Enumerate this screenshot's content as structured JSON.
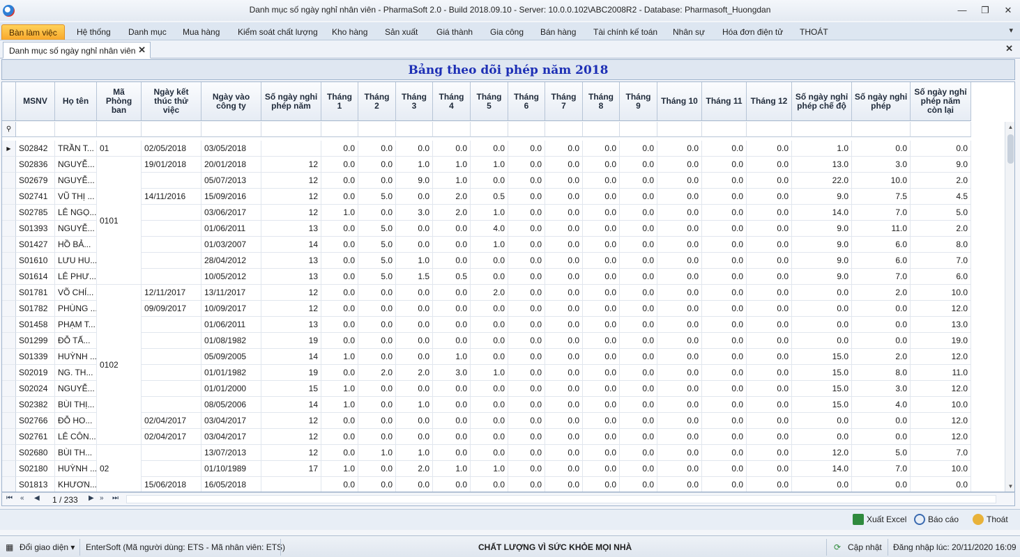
{
  "window": {
    "title": "Danh mục số ngày nghỉ nhân viên - PharmaSoft 2.0 - Build 2018.09.10 - Server: 10.0.0.102\\ABC2008R2 - Database: Pharmasoft_Huongdan",
    "minimize": "—",
    "restore": "❐",
    "close": "✕"
  },
  "menu": [
    "Bàn làm việc",
    "Hệ thống",
    "Danh mục",
    "Mua hàng",
    "Kiểm soát chất lượng",
    "Kho hàng",
    "Sản xuất",
    "Giá thành",
    "Gia công",
    "Bán hàng",
    "Tài chính kế toán",
    "Nhân sự",
    "Hóa đơn điện tử",
    "THOÁT"
  ],
  "doc_tab": {
    "label": "Danh mục số ngày nghỉ nhân viên",
    "close": "✕"
  },
  "grid_title": "Bảng theo dõi phép năm 2018",
  "columns": [
    "MSNV",
    "Họ tên",
    "Mã\nPhòng\nban",
    "Ngày kết\nthúc thử\nviệc",
    "Ngày vào\ncông ty",
    "Số ngày nghỉ\nphép năm",
    "Tháng\n1",
    "Tháng\n2",
    "Tháng\n3",
    "Tháng\n4",
    "Tháng\n5",
    "Tháng\n6",
    "Tháng\n7",
    "Tháng\n8",
    "Tháng\n9",
    "Tháng 10",
    "Tháng 11",
    "Tháng 12",
    "Số ngày nghỉ\nphép chế độ",
    "Số ngày nghỉ\nphép",
    "Số ngày nghỉ\nphép năm\ncòn lại"
  ],
  "dept_groups": [
    {
      "code": "01"
    },
    {
      "code": "0101"
    },
    {
      "code": "0102"
    },
    {
      "code": "02"
    }
  ],
  "rows": [
    [
      "S02842",
      "TRẦN T...",
      "02/05/2018",
      "03/05/2018",
      "",
      "0.0",
      "0.0",
      "0.0",
      "0.0",
      "0.0",
      "0.0",
      "0.0",
      "0.0",
      "0.0",
      "0.0",
      "0.0",
      "0.0",
      "1.0",
      "0.0",
      "0.0"
    ],
    [
      "S02836",
      "NGUYỄ...",
      "19/01/2018",
      "20/01/2018",
      "12",
      "0.0",
      "0.0",
      "1.0",
      "1.0",
      "1.0",
      "0.0",
      "0.0",
      "0.0",
      "0.0",
      "0.0",
      "0.0",
      "0.0",
      "13.0",
      "3.0",
      "9.0"
    ],
    [
      "S02679",
      "NGUYỄ...",
      "",
      "05/07/2013",
      "12",
      "0.0",
      "0.0",
      "9.0",
      "1.0",
      "0.0",
      "0.0",
      "0.0",
      "0.0",
      "0.0",
      "0.0",
      "0.0",
      "0.0",
      "22.0",
      "10.0",
      "2.0"
    ],
    [
      "S02741",
      "VŨ THỊ ...",
      "14/11/2016",
      "15/09/2016",
      "12",
      "0.0",
      "5.0",
      "0.0",
      "2.0",
      "0.5",
      "0.0",
      "0.0",
      "0.0",
      "0.0",
      "0.0",
      "0.0",
      "0.0",
      "9.0",
      "7.5",
      "4.5"
    ],
    [
      "S02785",
      "LÊ NGỌ...",
      "",
      "03/06/2017",
      "12",
      "1.0",
      "0.0",
      "3.0",
      "2.0",
      "1.0",
      "0.0",
      "0.0",
      "0.0",
      "0.0",
      "0.0",
      "0.0",
      "0.0",
      "14.0",
      "7.0",
      "5.0"
    ],
    [
      "S01393",
      "NGUYỄ...",
      "",
      "01/06/2011",
      "13",
      "0.0",
      "5.0",
      "0.0",
      "0.0",
      "4.0",
      "0.0",
      "0.0",
      "0.0",
      "0.0",
      "0.0",
      "0.0",
      "0.0",
      "9.0",
      "11.0",
      "2.0"
    ],
    [
      "S01427",
      "HỒ BẢ...",
      "",
      "01/03/2007",
      "14",
      "0.0",
      "5.0",
      "0.0",
      "0.0",
      "1.0",
      "0.0",
      "0.0",
      "0.0",
      "0.0",
      "0.0",
      "0.0",
      "0.0",
      "9.0",
      "6.0",
      "8.0"
    ],
    [
      "S01610",
      "LƯU HU...",
      "",
      "28/04/2012",
      "13",
      "0.0",
      "5.0",
      "1.0",
      "0.0",
      "0.0",
      "0.0",
      "0.0",
      "0.0",
      "0.0",
      "0.0",
      "0.0",
      "0.0",
      "9.0",
      "6.0",
      "7.0"
    ],
    [
      "S01614",
      "LÊ PHƯ...",
      "",
      "10/05/2012",
      "13",
      "0.0",
      "5.0",
      "1.5",
      "0.5",
      "0.0",
      "0.0",
      "0.0",
      "0.0",
      "0.0",
      "0.0",
      "0.0",
      "0.0",
      "9.0",
      "7.0",
      "6.0"
    ],
    [
      "S01781",
      "VÕ CHÍ...",
      "12/11/2017",
      "13/11/2017",
      "12",
      "0.0",
      "0.0",
      "0.0",
      "0.0",
      "2.0",
      "0.0",
      "0.0",
      "0.0",
      "0.0",
      "0.0",
      "0.0",
      "0.0",
      "0.0",
      "2.0",
      "10.0"
    ],
    [
      "S01782",
      "PHÙNG ...",
      "09/09/2017",
      "10/09/2017",
      "12",
      "0.0",
      "0.0",
      "0.0",
      "0.0",
      "0.0",
      "0.0",
      "0.0",
      "0.0",
      "0.0",
      "0.0",
      "0.0",
      "0.0",
      "0.0",
      "0.0",
      "12.0"
    ],
    [
      "S01458",
      "PHẠM T...",
      "",
      "01/06/2011",
      "13",
      "0.0",
      "0.0",
      "0.0",
      "0.0",
      "0.0",
      "0.0",
      "0.0",
      "0.0",
      "0.0",
      "0.0",
      "0.0",
      "0.0",
      "0.0",
      "0.0",
      "13.0"
    ],
    [
      "S01299",
      "ĐỖ TẤ...",
      "",
      "01/08/1982",
      "19",
      "0.0",
      "0.0",
      "0.0",
      "0.0",
      "0.0",
      "0.0",
      "0.0",
      "0.0",
      "0.0",
      "0.0",
      "0.0",
      "0.0",
      "0.0",
      "0.0",
      "19.0"
    ],
    [
      "S01339",
      "HUỲNH ...",
      "",
      "05/09/2005",
      "14",
      "1.0",
      "0.0",
      "0.0",
      "1.0",
      "0.0",
      "0.0",
      "0.0",
      "0.0",
      "0.0",
      "0.0",
      "0.0",
      "0.0",
      "15.0",
      "2.0",
      "12.0"
    ],
    [
      "S02019",
      "NG. TH...",
      "",
      "01/01/1982",
      "19",
      "0.0",
      "2.0",
      "2.0",
      "3.0",
      "1.0",
      "0.0",
      "0.0",
      "0.0",
      "0.0",
      "0.0",
      "0.0",
      "0.0",
      "15.0",
      "8.0",
      "11.0"
    ],
    [
      "S02024",
      "NGUYỄ...",
      "",
      "01/01/2000",
      "15",
      "1.0",
      "0.0",
      "0.0",
      "0.0",
      "0.0",
      "0.0",
      "0.0",
      "0.0",
      "0.0",
      "0.0",
      "0.0",
      "0.0",
      "15.0",
      "3.0",
      "12.0"
    ],
    [
      "S02382",
      "BÙI THỊ...",
      "",
      "08/05/2006",
      "14",
      "1.0",
      "0.0",
      "1.0",
      "0.0",
      "0.0",
      "0.0",
      "0.0",
      "0.0",
      "0.0",
      "0.0",
      "0.0",
      "0.0",
      "15.0",
      "4.0",
      "10.0"
    ],
    [
      "S02766",
      "ĐỖ HO...",
      "02/04/2017",
      "03/04/2017",
      "12",
      "0.0",
      "0.0",
      "0.0",
      "0.0",
      "0.0",
      "0.0",
      "0.0",
      "0.0",
      "0.0",
      "0.0",
      "0.0",
      "0.0",
      "0.0",
      "0.0",
      "12.0"
    ],
    [
      "S02761",
      "LÊ CÔN...",
      "02/04/2017",
      "03/04/2017",
      "12",
      "0.0",
      "0.0",
      "0.0",
      "0.0",
      "0.0",
      "0.0",
      "0.0",
      "0.0",
      "0.0",
      "0.0",
      "0.0",
      "0.0",
      "0.0",
      "0.0",
      "12.0"
    ],
    [
      "S02680",
      "BÙI TH...",
      "",
      "13/07/2013",
      "12",
      "0.0",
      "1.0",
      "1.0",
      "0.0",
      "0.0",
      "0.0",
      "0.0",
      "0.0",
      "0.0",
      "0.0",
      "0.0",
      "0.0",
      "12.0",
      "5.0",
      "7.0"
    ],
    [
      "S02180",
      "HUỲNH ...",
      "",
      "01/10/1989",
      "17",
      "1.0",
      "0.0",
      "2.0",
      "1.0",
      "1.0",
      "0.0",
      "0.0",
      "0.0",
      "0.0",
      "0.0",
      "0.0",
      "0.0",
      "14.0",
      "7.0",
      "10.0"
    ],
    [
      "S01813",
      "KHƯƠN...",
      "15/06/2018",
      "16/05/2018",
      "",
      "0.0",
      "0.0",
      "0.0",
      "0.0",
      "0.0",
      "0.0",
      "0.0",
      "0.0",
      "0.0",
      "0.0",
      "0.0",
      "0.0",
      "0.0",
      "0.0",
      "0.0"
    ]
  ],
  "navigator": {
    "first": "⏮",
    "prev_page": "«",
    "prev": "◀",
    "position": "1 / 233",
    "next": "▶",
    "next_page": "»",
    "last": "⏭"
  },
  "toolbar": {
    "excel": "Xuất Excel",
    "report": "Báo cáo",
    "exit": "Thoát"
  },
  "status": {
    "theme": "Đổi giao diện",
    "user": "EnterSoft (Mã người dùng: ETS - Mã nhân viên: ETS)",
    "slogan": "CHẤT LƯỢNG VÌ SỨC KHỎE MỌI NHÀ",
    "update": "Cập nhật",
    "login": "Đăng nhập lúc: 20/11/2020 16:09"
  },
  "colors": {
    "title_blue": "#1d2fb5",
    "active_menu": "#f8a82b"
  }
}
